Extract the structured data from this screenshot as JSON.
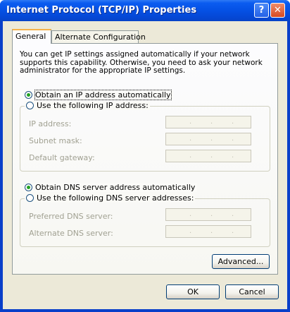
{
  "window": {
    "title": "Internet Protocol (TCP/IP) Properties",
    "help_glyph": "?",
    "close_glyph": "✕"
  },
  "tabs": [
    {
      "label": "General",
      "selected": true
    },
    {
      "label": "Alternate Configuration",
      "selected": false
    }
  ],
  "description": "You can get IP settings assigned automatically if your network supports this capability. Otherwise, you need to ask your network administrator for the appropriate IP settings.",
  "ip_section": {
    "obtain_auto_label": "Obtain an IP address automatically",
    "obtain_auto_selected": true,
    "use_following_label": "Use the following IP address:",
    "fields": [
      {
        "label": "IP address:",
        "value": ""
      },
      {
        "label": "Subnet mask:",
        "value": ""
      },
      {
        "label": "Default gateway:",
        "value": ""
      }
    ]
  },
  "dns_section": {
    "obtain_auto_label": "Obtain DNS server address automatically",
    "obtain_auto_selected": true,
    "use_following_label": "Use the following DNS server addresses:",
    "fields": [
      {
        "label": "Preferred DNS server:",
        "value": ""
      },
      {
        "label": "Alternate DNS server:",
        "value": ""
      }
    ]
  },
  "ip_dot": ".",
  "buttons": {
    "advanced": "Advanced...",
    "ok": "OK",
    "cancel": "Cancel"
  },
  "colors": {
    "titlebar": "#0552e6",
    "dialog_bg": "#ece9d8",
    "radio_dot": "#21a121"
  }
}
